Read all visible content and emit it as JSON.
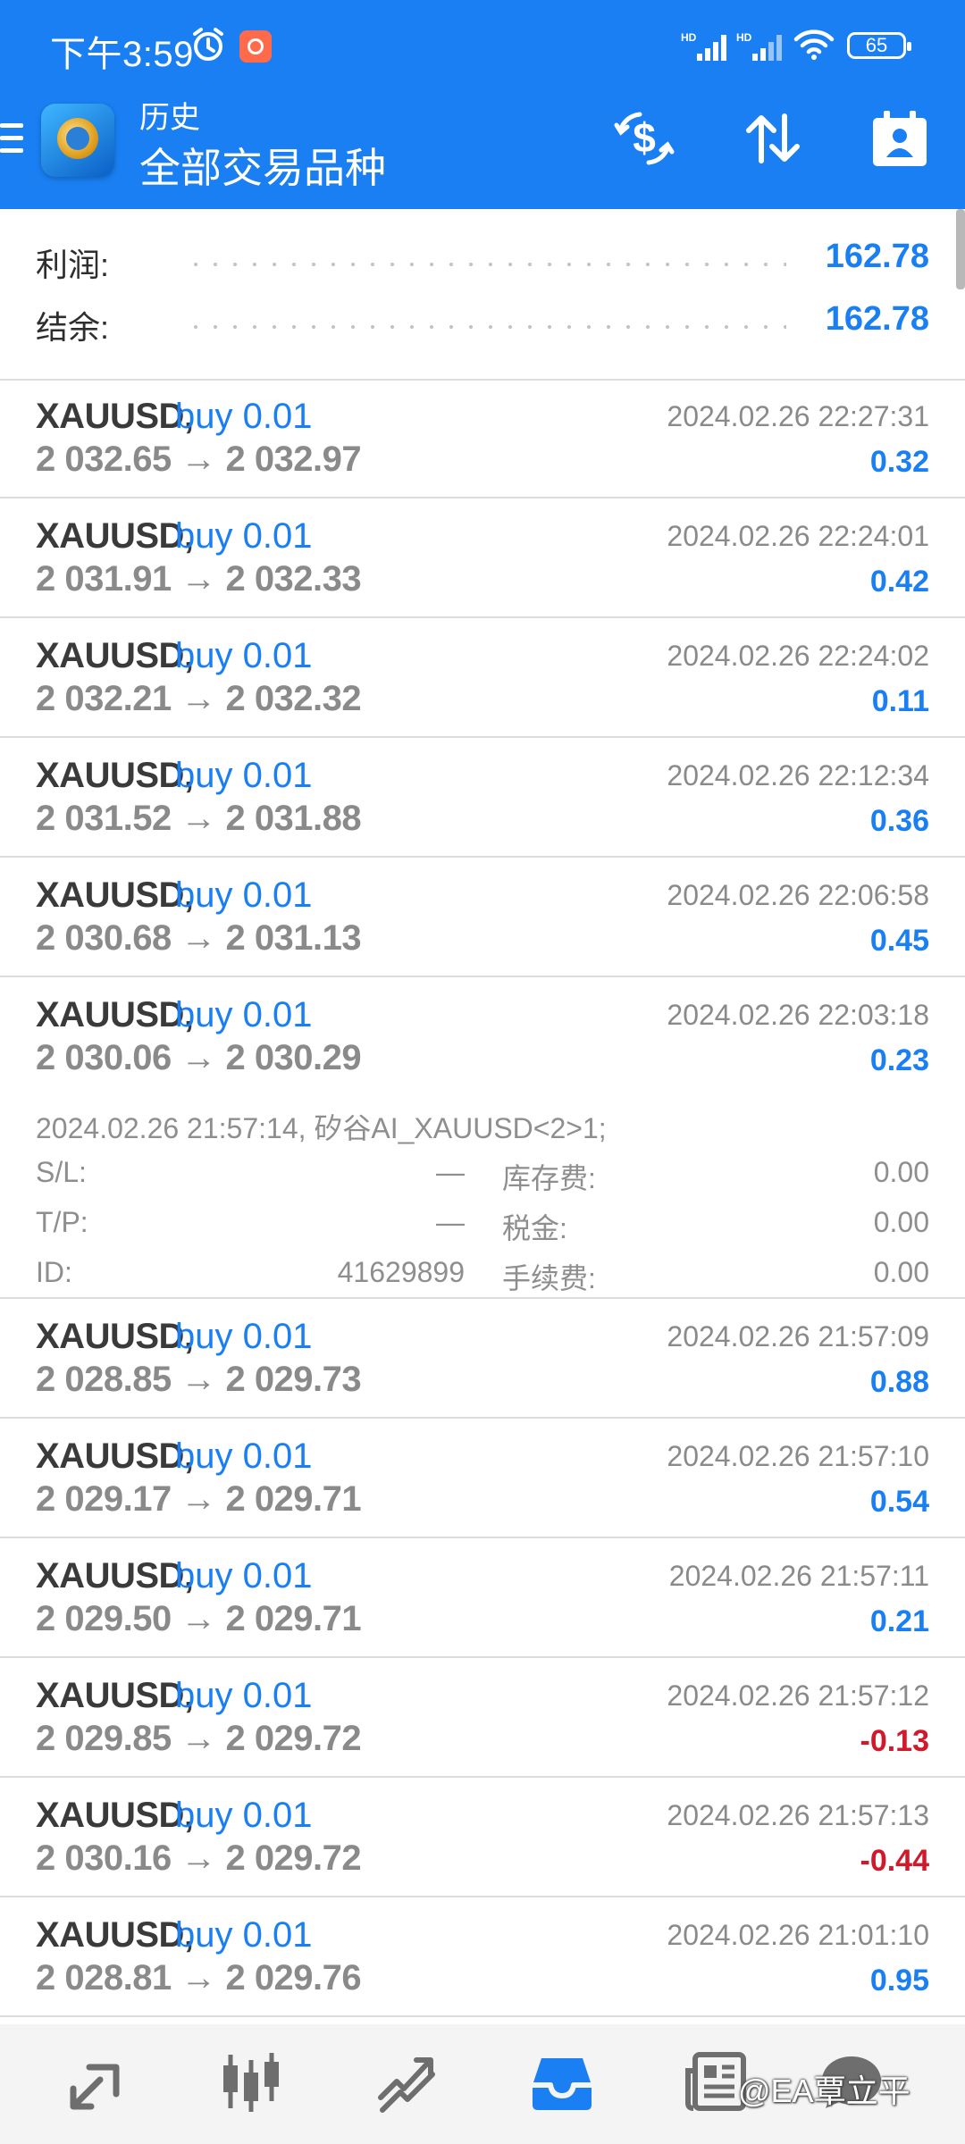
{
  "status_bar": {
    "time": "下午3:59",
    "battery": "65",
    "network_label": "HD"
  },
  "header": {
    "title": "历史",
    "subtitle": "全部交易品种"
  },
  "summary": [
    {
      "label": "利润:",
      "value": "162.78"
    },
    {
      "label": "结余:",
      "value": "162.78"
    }
  ],
  "deals": [
    {
      "symbol": "XAUUSD,",
      "type": "buy 0.01",
      "open_price": "2 032.65",
      "close_price": "2 032.97",
      "time": "2024.02.26 22:27:31",
      "profit": "0.32"
    },
    {
      "symbol": "XAUUSD,",
      "type": "buy 0.01",
      "open_price": "2 031.91",
      "close_price": "2 032.33",
      "time": "2024.02.26 22:24:01",
      "profit": "0.42"
    },
    {
      "symbol": "XAUUSD,",
      "type": "buy 0.01",
      "open_price": "2 032.21",
      "close_price": "2 032.32",
      "time": "2024.02.26 22:24:02",
      "profit": "0.11"
    },
    {
      "symbol": "XAUUSD,",
      "type": "buy 0.01",
      "open_price": "2 031.52",
      "close_price": "2 031.88",
      "time": "2024.02.26 22:12:34",
      "profit": "0.36"
    },
    {
      "symbol": "XAUUSD,",
      "type": "buy 0.01",
      "open_price": "2 030.68",
      "close_price": "2 031.13",
      "time": "2024.02.26 22:06:58",
      "profit": "0.45"
    },
    {
      "symbol": "XAUUSD,",
      "type": "buy 0.01",
      "open_price": "2 030.06",
      "close_price": "2 030.29",
      "time": "2024.02.26 22:03:18",
      "profit": "0.23"
    },
    {
      "symbol": "XAUUSD,",
      "type": "buy 0.01",
      "open_price": "2 028.85",
      "close_price": "2 029.73",
      "time": "2024.02.26 21:57:09",
      "profit": "0.88"
    },
    {
      "symbol": "XAUUSD,",
      "type": "buy 0.01",
      "open_price": "2 029.17",
      "close_price": "2 029.71",
      "time": "2024.02.26 21:57:10",
      "profit": "0.54"
    },
    {
      "symbol": "XAUUSD,",
      "type": "buy 0.01",
      "open_price": "2 029.50",
      "close_price": "2 029.71",
      "time": "2024.02.26 21:57:11",
      "profit": "0.21"
    },
    {
      "symbol": "XAUUSD,",
      "type": "buy 0.01",
      "open_price": "2 029.85",
      "close_price": "2 029.72",
      "time": "2024.02.26 21:57:12",
      "profit": "-0.13"
    },
    {
      "symbol": "XAUUSD,",
      "type": "buy 0.01",
      "open_price": "2 030.16",
      "close_price": "2 029.72",
      "time": "2024.02.26 21:57:13",
      "profit": "-0.44"
    },
    {
      "symbol": "XAUUSD,",
      "type": "buy 0.01",
      "open_price": "2 028.81",
      "close_price": "2 029.76",
      "time": "2024.02.26 21:01:10",
      "profit": "0.95"
    }
  ],
  "expanded_detail": {
    "comment": "2024.02.26 21:57:14, 矽谷AI_XAUUSD<2>1;",
    "sl_label": "S/L:",
    "sl_value": "—",
    "tp_label": "T/P:",
    "tp_value": "—",
    "id_label": "ID:",
    "id_value": "41629899",
    "swap_label": "库存费:",
    "swap_value": "0.00",
    "tax_label": "税金:",
    "tax_value": "0.00",
    "fee_label": "手续费:",
    "fee_value": "0.00"
  },
  "watermark": "@EA覃立平",
  "icons": {
    "toolbar": [
      "currency-exchange-icon",
      "sort-icon",
      "calendar-user-icon"
    ],
    "bottom_nav": [
      "quotes-icon",
      "chart-icon",
      "trade-icon",
      "history-icon",
      "news-icon",
      "messages-icon"
    ]
  },
  "colors": {
    "accent": "#1a7ff2",
    "negative": "#d0192b",
    "muted": "#8a8a8a"
  }
}
